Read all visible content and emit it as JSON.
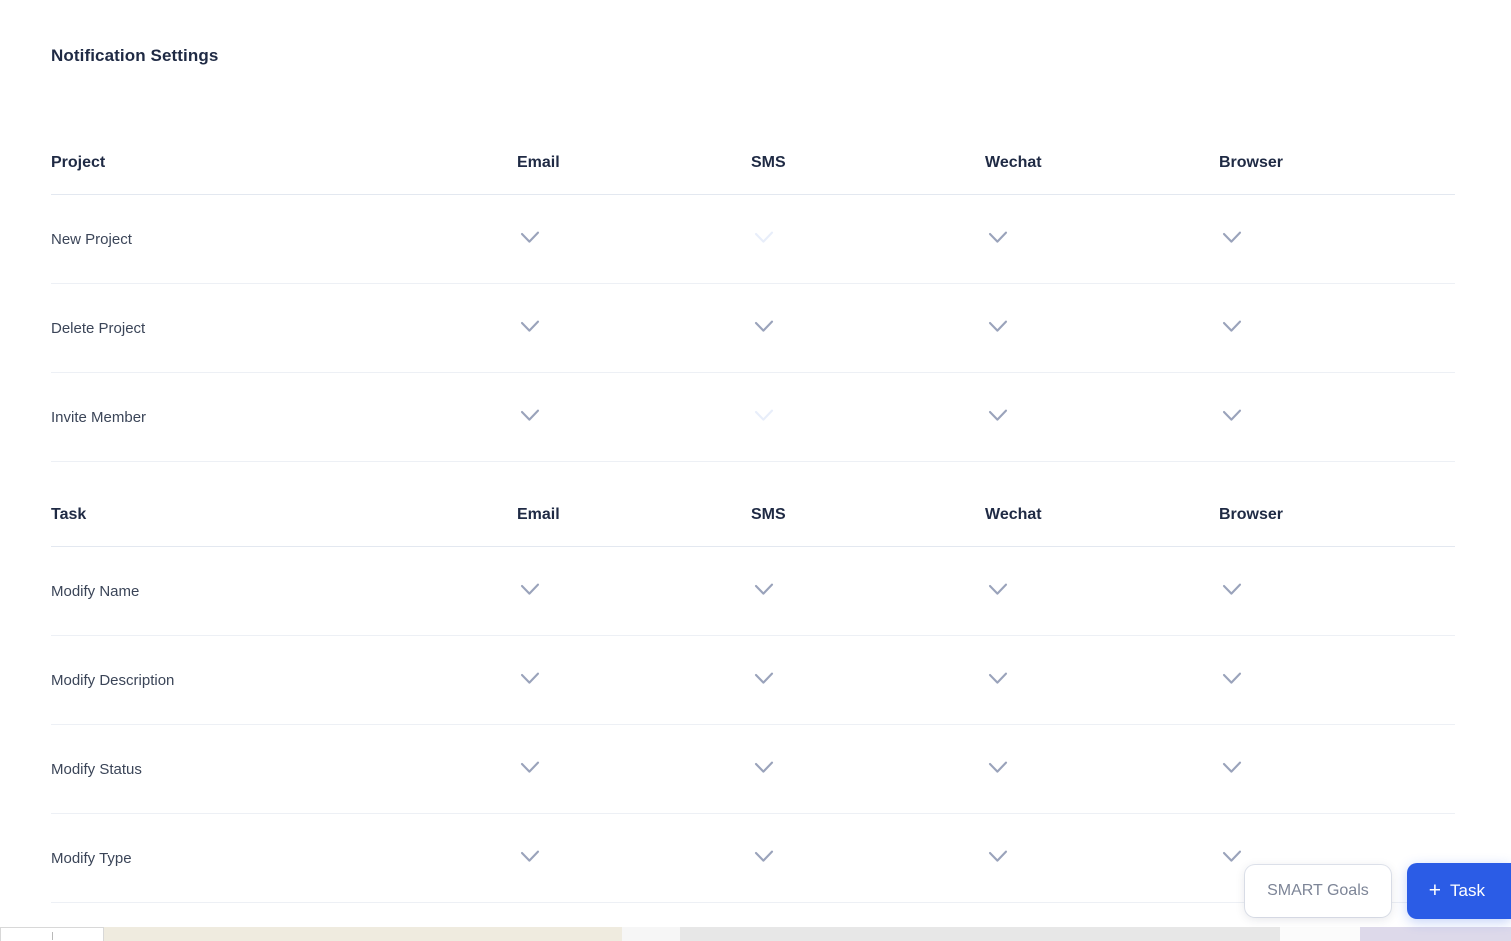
{
  "page": {
    "title": "Notification Settings"
  },
  "columns": [
    "Email",
    "SMS",
    "Wechat",
    "Browser"
  ],
  "sections": [
    {
      "name": "project-section",
      "header": "Project",
      "columns": [
        "Email",
        "SMS",
        "Wechat",
        "Browser"
      ],
      "rows": [
        {
          "label": "New Project",
          "email": true,
          "sms": false,
          "wechat": true,
          "browser": true
        },
        {
          "label": "Delete Project",
          "email": true,
          "sms": true,
          "wechat": true,
          "browser": true
        },
        {
          "label": "Invite Member",
          "email": true,
          "sms": false,
          "wechat": true,
          "browser": true
        }
      ]
    },
    {
      "name": "task-section",
      "header": "Task",
      "columns": [
        "Email",
        "SMS",
        "Wechat",
        "Browser"
      ],
      "rows": [
        {
          "label": "Modify Name",
          "email": true,
          "sms": true,
          "wechat": true,
          "browser": true
        },
        {
          "label": "Modify Description",
          "email": true,
          "sms": true,
          "wechat": true,
          "browser": true
        },
        {
          "label": "Modify Status",
          "email": true,
          "sms": true,
          "wechat": true,
          "browser": true
        },
        {
          "label": "Modify Type",
          "email": true,
          "sms": true,
          "wechat": true,
          "browser": true
        }
      ]
    }
  ],
  "floating_actions": {
    "smart_goals_label": "SMART Goals",
    "add_task_plus": "+",
    "add_task_label": "Task"
  },
  "icons": {
    "check": "check-icon",
    "plus": "plus-icon"
  },
  "colors": {
    "accent": "#2b5ce6",
    "title": "#1f2a44",
    "check_on": "#9aa3bb",
    "check_off": "#e8eefa",
    "row_divider": "#edf0f5",
    "header_divider": "#e3e8f0",
    "background": "#ffffff"
  }
}
